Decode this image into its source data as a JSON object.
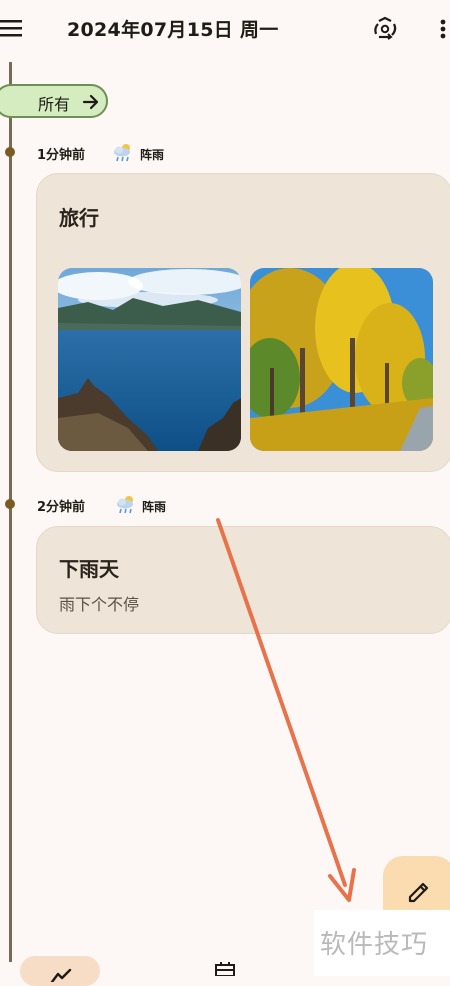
{
  "header": {
    "title": "2024年07月15日 周一",
    "menu_icon": "menu-icon",
    "sync_icon": "sync-icon",
    "more_icon": "more-vert-icon"
  },
  "filter": {
    "label": "所有",
    "icon": "arrow-right-icon"
  },
  "entries": [
    {
      "time": "1分钟前",
      "weather": "阵雨",
      "weather_icon": "rain-shower-icon",
      "title": "旅行",
      "photos": [
        "lake-mountain-photo",
        "ginkgo-trees-photo"
      ]
    },
    {
      "time": "2分钟前",
      "weather": "阵雨",
      "weather_icon": "rain-shower-icon",
      "title": "下雨天",
      "body": "雨下个不停"
    }
  ],
  "fab": {
    "icon": "edit-pencil-icon"
  },
  "watermark": "软件技巧",
  "colors": {
    "background": "#fdf8f6",
    "card": "#efe4d8",
    "chip": "#d5ecc0",
    "fab": "#fbdcb0",
    "annotation_arrow": "#e8734a"
  }
}
